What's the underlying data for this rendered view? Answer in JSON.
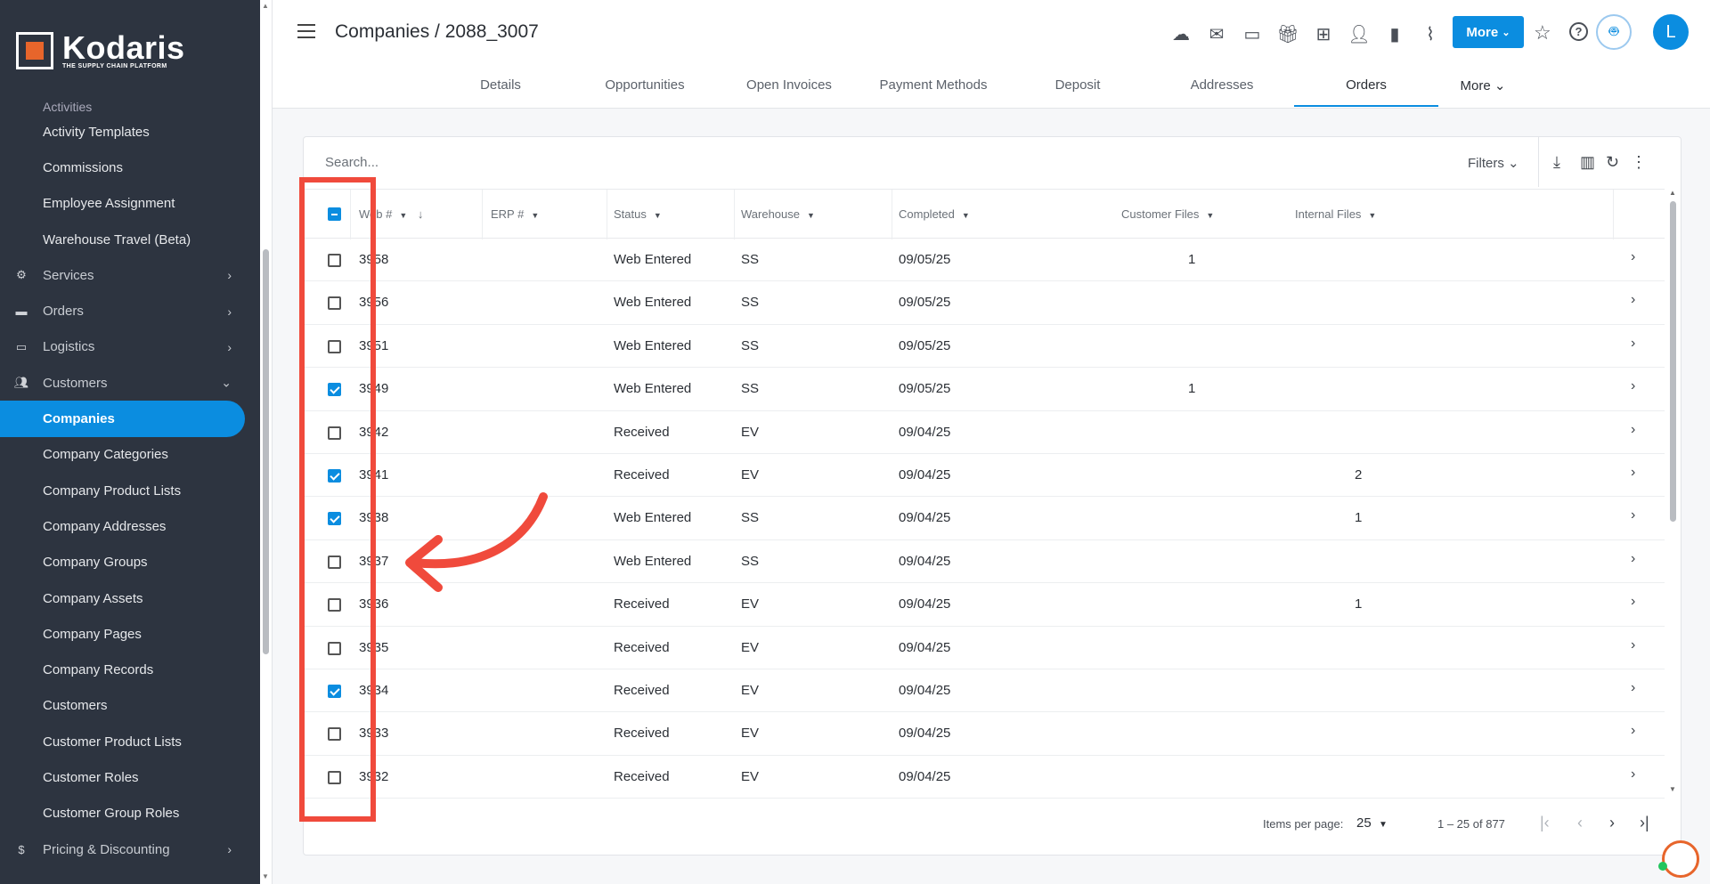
{
  "brand": {
    "name": "Kodaris",
    "tagline": "THE SUPPLY CHAIN PLATFORM"
  },
  "sidebar": {
    "items": [
      {
        "label": "Activities",
        "type": "partial"
      },
      {
        "label": "Activity Templates",
        "type": "sub"
      },
      {
        "label": "Commissions",
        "type": "sub"
      },
      {
        "label": "Employee Assignment",
        "type": "sub"
      },
      {
        "label": "Warehouse Travel (Beta)",
        "type": "sub"
      },
      {
        "label": "Services",
        "type": "section",
        "icon": "gears-icon",
        "chevron": "right"
      },
      {
        "label": "Orders",
        "type": "section",
        "icon": "truck-icon",
        "chevron": "right"
      },
      {
        "label": "Logistics",
        "type": "section",
        "icon": "delivery-icon",
        "chevron": "right"
      },
      {
        "label": "Customers",
        "type": "section",
        "icon": "people-icon",
        "chevron": "down"
      },
      {
        "label": "Companies",
        "type": "sub",
        "active": true
      },
      {
        "label": "Company Categories",
        "type": "sub"
      },
      {
        "label": "Company Product Lists",
        "type": "sub"
      },
      {
        "label": "Company Addresses",
        "type": "sub"
      },
      {
        "label": "Company Groups",
        "type": "sub"
      },
      {
        "label": "Company Assets",
        "type": "sub"
      },
      {
        "label": "Company Pages",
        "type": "sub"
      },
      {
        "label": "Company Records",
        "type": "sub"
      },
      {
        "label": "Customers",
        "type": "sub"
      },
      {
        "label": "Customer Product Lists",
        "type": "sub"
      },
      {
        "label": "Customer Roles",
        "type": "sub"
      },
      {
        "label": "Customer Group Roles",
        "type": "sub"
      },
      {
        "label": "Pricing & Discounting",
        "type": "section",
        "icon": "dollar-icon",
        "chevron": "right"
      }
    ]
  },
  "header": {
    "title": "Companies / 2088_3007",
    "more_label": "More",
    "avatar_initial": "L",
    "icons": [
      "cloud-lock-icon",
      "mail-icon",
      "card-icon",
      "gift-icon",
      "monitor-add-icon",
      "person-add-icon",
      "file-add-icon",
      "paperclip-icon"
    ]
  },
  "tabs": {
    "items": [
      "Details",
      "Opportunities",
      "Open Invoices",
      "Payment Methods",
      "Deposit",
      "Addresses",
      "Orders"
    ],
    "active": "Orders",
    "more_label": "More"
  },
  "table": {
    "search_placeholder": "Search...",
    "filters_label": "Filters",
    "columns": [
      "Web #",
      "ERP #",
      "Status",
      "Warehouse",
      "Completed",
      "Customer Files",
      "Internal Files"
    ],
    "rows": [
      {
        "web": "3958",
        "erp": "",
        "status": "Web Entered",
        "warehouse": "SS",
        "completed": "09/05/25",
        "customer_files": "1",
        "internal_files": "",
        "checked": false
      },
      {
        "web": "3956",
        "erp": "",
        "status": "Web Entered",
        "warehouse": "SS",
        "completed": "09/05/25",
        "customer_files": "",
        "internal_files": "",
        "checked": false
      },
      {
        "web": "3951",
        "erp": "",
        "status": "Web Entered",
        "warehouse": "SS",
        "completed": "09/05/25",
        "customer_files": "",
        "internal_files": "",
        "checked": false
      },
      {
        "web": "3949",
        "erp": "",
        "status": "Web Entered",
        "warehouse": "SS",
        "completed": "09/05/25",
        "customer_files": "1",
        "internal_files": "",
        "checked": true
      },
      {
        "web": "3942",
        "erp": "",
        "status": "Received",
        "warehouse": "EV",
        "completed": "09/04/25",
        "customer_files": "",
        "internal_files": "",
        "checked": false
      },
      {
        "web": "3941",
        "erp": "",
        "status": "Received",
        "warehouse": "EV",
        "completed": "09/04/25",
        "customer_files": "",
        "internal_files": "2",
        "checked": true
      },
      {
        "web": "3938",
        "erp": "",
        "status": "Web Entered",
        "warehouse": "SS",
        "completed": "09/04/25",
        "customer_files": "",
        "internal_files": "1",
        "checked": true
      },
      {
        "web": "3937",
        "erp": "",
        "status": "Web Entered",
        "warehouse": "SS",
        "completed": "09/04/25",
        "customer_files": "",
        "internal_files": "",
        "checked": false
      },
      {
        "web": "3936",
        "erp": "",
        "status": "Received",
        "warehouse": "EV",
        "completed": "09/04/25",
        "customer_files": "",
        "internal_files": "1",
        "checked": false
      },
      {
        "web": "3935",
        "erp": "",
        "status": "Received",
        "warehouse": "EV",
        "completed": "09/04/25",
        "customer_files": "",
        "internal_files": "",
        "checked": false
      },
      {
        "web": "3934",
        "erp": "",
        "status": "Received",
        "warehouse": "EV",
        "completed": "09/04/25",
        "customer_files": "",
        "internal_files": "",
        "checked": true
      },
      {
        "web": "3933",
        "erp": "",
        "status": "Received",
        "warehouse": "EV",
        "completed": "09/04/25",
        "customer_files": "",
        "internal_files": "",
        "checked": false
      },
      {
        "web": "3932",
        "erp": "",
        "status": "Received",
        "warehouse": "EV",
        "completed": "09/04/25",
        "customer_files": "",
        "internal_files": "",
        "checked": false
      }
    ],
    "footer": {
      "items_per_page_label": "Items per page:",
      "items_per_page": "25",
      "range": "1 – 25 of 877"
    }
  },
  "colors": {
    "accent": "#0b8de0",
    "sidebar_bg": "#2d3440",
    "annotation": "#f04a3c",
    "brand_orange": "#e7652b"
  }
}
